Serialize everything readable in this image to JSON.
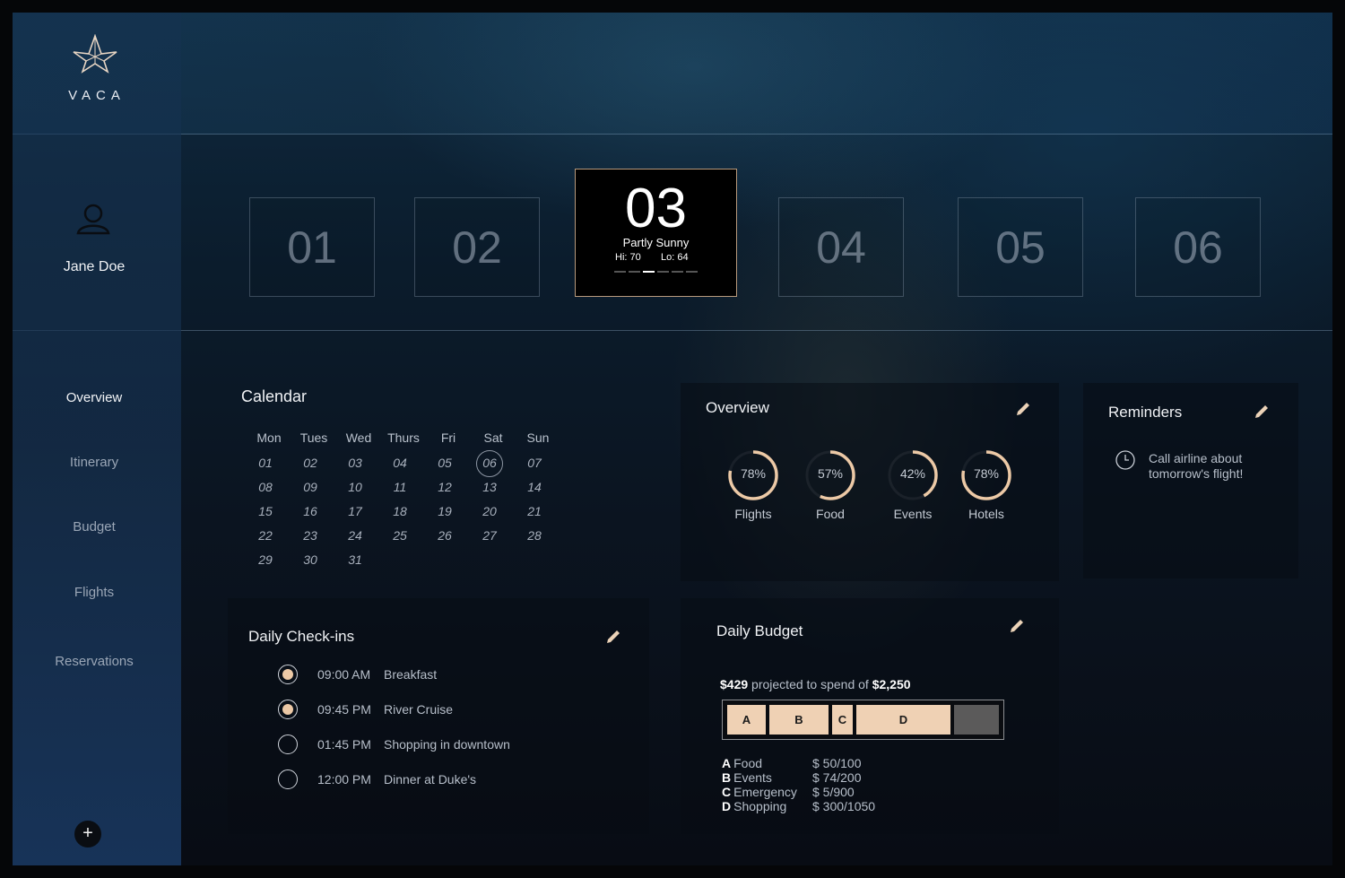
{
  "brand": "VACA",
  "user": {
    "name": "Jane Doe"
  },
  "nav": [
    "Overview",
    "Itinerary",
    "Budget",
    "Flights",
    "Reservations"
  ],
  "days": {
    "items": [
      "01",
      "02",
      "03",
      "04",
      "05",
      "06"
    ],
    "active": {
      "number": "03",
      "condition": "Partly Sunny",
      "hi": "Hi: 70",
      "lo": "Lo: 64"
    }
  },
  "calendar": {
    "title": "Calendar",
    "weekdays": [
      "Mon",
      "Tues",
      "Wed",
      "Thurs",
      "Fri",
      "Sat",
      "Sun"
    ],
    "dates": [
      "01",
      "02",
      "03",
      "04",
      "05",
      "06",
      "07",
      "08",
      "09",
      "10",
      "11",
      "12",
      "13",
      "14",
      "15",
      "16",
      "17",
      "18",
      "19",
      "20",
      "21",
      "22",
      "23",
      "24",
      "25",
      "26",
      "27",
      "28",
      "29",
      "30",
      "31"
    ],
    "selected": "06"
  },
  "overview": {
    "title": "Overview",
    "rings": [
      {
        "label": "Flights",
        "value": "78%",
        "pct": 78
      },
      {
        "label": "Food",
        "value": "57%",
        "pct": 57
      },
      {
        "label": "Events",
        "value": "42%",
        "pct": 42
      },
      {
        "label": "Hotels",
        "value": "78%",
        "pct": 78
      }
    ]
  },
  "reminders": {
    "title": "Reminders",
    "items": [
      "Call airline about tomorrow's flight!"
    ]
  },
  "checkins": {
    "title": "Daily Check-ins",
    "items": [
      {
        "time": "09:00 AM",
        "text": "Breakfast",
        "done": true
      },
      {
        "time": "09:45 PM",
        "text": "River Cruise",
        "done": true
      },
      {
        "time": "01:45 PM",
        "text": "Shopping in downtown",
        "done": false
      },
      {
        "time": "12:00 PM",
        "text": "Dinner at Duke's",
        "done": false
      }
    ]
  },
  "budget": {
    "title": "Daily Budget",
    "projected": "$429",
    "projected_text": "projected to spend of",
    "total": "$2,250",
    "segments": [
      {
        "key": "A",
        "share": 0.155
      },
      {
        "key": "B",
        "share": 0.23
      },
      {
        "key": "C",
        "share": 0.09
      },
      {
        "key": "D",
        "share": 0.36
      }
    ],
    "legend": [
      {
        "key": "A",
        "name": "Food",
        "amount": "$ 50/100"
      },
      {
        "key": "B",
        "name": "Events",
        "amount": "$ 74/200"
      },
      {
        "key": "C",
        "name": "Emergency",
        "amount": "$ 5/900"
      },
      {
        "key": "D",
        "name": "Shopping",
        "amount": "$ 300/1050"
      }
    ]
  },
  "colors": {
    "accent": "#efd1b4",
    "ring": "#ecc9a6",
    "panel": "#0a0e16"
  },
  "icons": {
    "logo": "star-logo-icon",
    "avatar": "user-icon",
    "edit": "pencil-icon",
    "add": "plus-icon",
    "clock": "clock-icon"
  }
}
